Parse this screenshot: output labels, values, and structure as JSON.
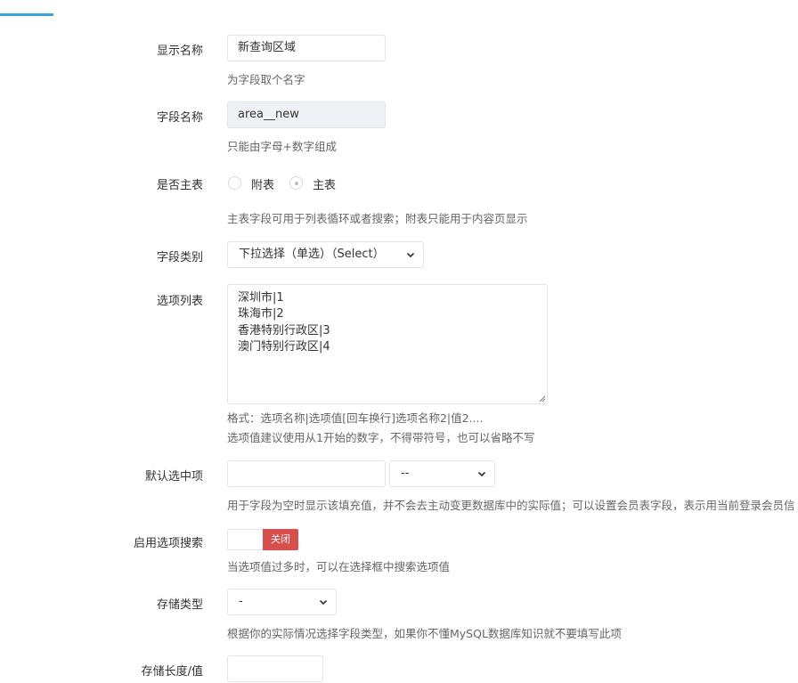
{
  "form": {
    "display_name": {
      "label": "显示名称",
      "value": "新查询区域",
      "help": "为字段取个名字"
    },
    "field_name": {
      "label": "字段名称",
      "value": "area__new",
      "help": "只能由字母+数字组成"
    },
    "main_table": {
      "label": "是否主表",
      "options": [
        "附表",
        "主表"
      ],
      "selected": "主表",
      "help": "主表字段可用于列表循环或者搜索；附表只能用于内容页显示"
    },
    "field_type": {
      "label": "字段类别",
      "selected": "下拉选择（单选）（Select）"
    },
    "option_list": {
      "label": "选项列表",
      "lines": [
        "深圳市|1",
        "珠海市|2",
        "香港特别行政区|3",
        "澳门特别行政区|4"
      ],
      "help1": "格式：选项名称|选项值[回车换行]选项名称2|值2....",
      "help2": "选项值建议使用从1开始的数字，不得带符号，也可以省略不写"
    },
    "default_option": {
      "label": "默认选中项",
      "value": "",
      "select_value": "--",
      "help": "用于字段为空时显示该填充值，并不会去主动变更数据库中的实际值；可以设置会员表字段，表示用当前登录会员信"
    },
    "enable_search": {
      "label": "启用选项搜索",
      "toggle_text": "关闭",
      "help": "当选项值过多时，可以在选择框中搜索选项值"
    },
    "storage_type": {
      "label": "存储类型",
      "selected": "-",
      "help": "根据你的实际情况选择字段类型，如果你不懂MySQL数据库知识就不要填写此项"
    },
    "storage_length": {
      "label": "存储长度/值",
      "value": ""
    }
  },
  "colors": {
    "accent": "#36a5d8",
    "toggle_off": "#d64f4c",
    "readonly_bg": "#eef1f5"
  }
}
